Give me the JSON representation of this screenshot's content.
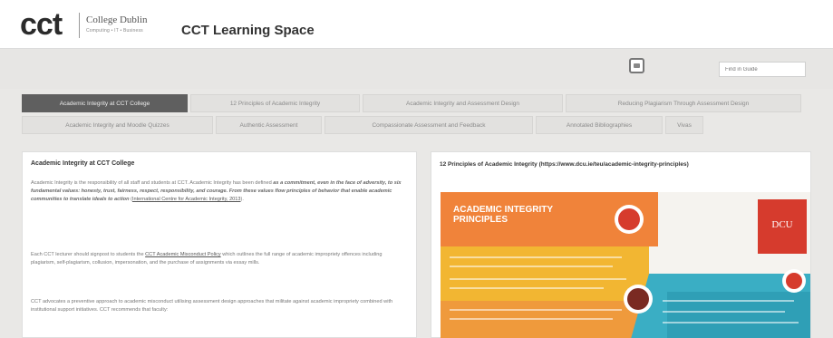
{
  "header": {
    "logo_text": "cct",
    "college_name": "College Dublin",
    "tagline": "Computing • IT • Business",
    "site_title": "CCT Learning Space"
  },
  "toolbar": {
    "search_placeholder": "Find in Guide",
    "print_icon": "print-icon"
  },
  "tabs": [
    {
      "label": "Academic Integrity at CCT College",
      "active": true
    },
    {
      "label": "12 Principles of Academic Integrity",
      "active": false
    },
    {
      "label": "Academic Integrity and Assessment Design",
      "active": false
    },
    {
      "label": "Reducing Plagiarism Through Assessment Design",
      "active": false
    },
    {
      "label": "Academic Integrity and Moodle Quizzes",
      "active": false
    },
    {
      "label": "Authentic Assessment",
      "active": false
    },
    {
      "label": "Compassionate Assessment and Feedback",
      "active": false
    },
    {
      "label": "Annotated Bibliographies",
      "active": false
    },
    {
      "label": "Vivas",
      "active": false
    }
  ],
  "left_panel": {
    "title": "Academic Integrity at CCT College",
    "p1_a": "Academic Integrity is the responsibility of all staff and students at CCT. Academic Integrity has been defined ",
    "p1_quote": "as a commitment, even in the face of adversity, to six fundamental values: honesty, trust, fairness, respect, responsibility, and courage. From these values flow principles of behavior that enable academic communities to translate ideals to action",
    "p1_b": " (",
    "p1_link": "International Centre for Academic Integrity, 2013",
    "p1_c": ").",
    "p2_a": "Each CCT lecturer should signpost to students the ",
    "p2_link": "CCT Academic Misconduct Policy",
    "p2_b": " which outlines the full range of academic impropriety offences including plagiarism, self-plagiarism, collusion, impersonation, and the purchase of assignments via essay mills.",
    "p3": "CCT advocates a preventive approach to academic misconduct utilising assessment design approaches that militate against academic impropriety combined with institutional support initiatives. CCT recommends that faculty:"
  },
  "right_panel": {
    "title": "12 Principles of Academic Integrity (https://www.dcu.ie/teu/academic-integrity-principles)",
    "infographic": {
      "heading_line1": "ACADEMIC INTEGRITY",
      "heading_line2": "PRINCIPLES",
      "badge": "DCU",
      "colors": {
        "orange": "#f0833a",
        "yellow": "#f2b632",
        "teal": "#3aaec4",
        "red": "#d63b2d",
        "dark": "#3b3b3b"
      }
    }
  }
}
